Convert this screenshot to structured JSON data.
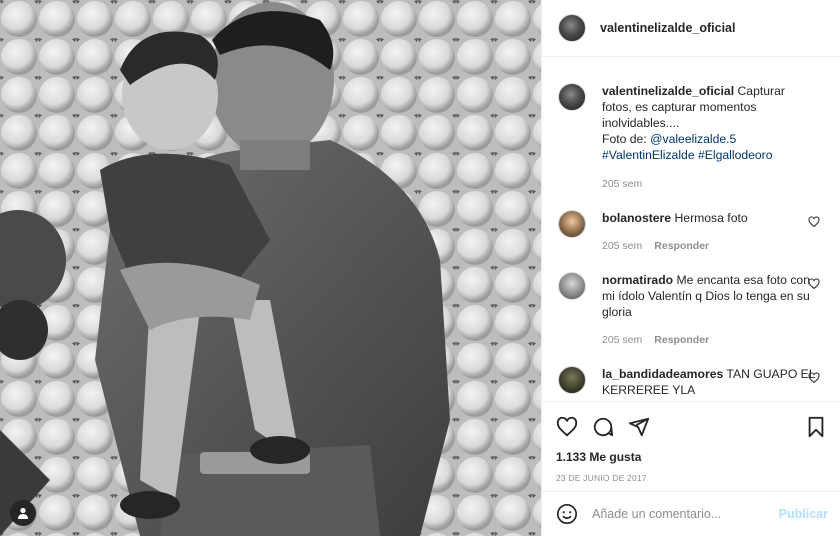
{
  "post": {
    "author": "valentinelizalde_oficial",
    "photo_alt": "Black and white photo"
  },
  "caption": {
    "user": "valentinelizalde_oficial",
    "text": "Capturar fotos, es capturar momentos inolvidables....",
    "credit_prefix": "Foto de: ",
    "credit_handle": "@valeelizalde.5",
    "hashtags": "#ValentinElizalde #Elgallodeoro",
    "time": "205 sem"
  },
  "comments": [
    {
      "user": "bolanostere",
      "text": "Hermosa foto",
      "time": "205 sem",
      "reply": "Responder"
    },
    {
      "user": "normatirado",
      "text": "Me encanta esa foto con mi ídolo Valentín q Dios lo tenga en su gloria",
      "time": "205 sem",
      "reply": "Responder"
    },
    {
      "user": "la_bandidadeamores",
      "text": "TAN GUAPO EL KERREREE YLA",
      "time": "",
      "reply": ""
    }
  ],
  "stats": {
    "likes": "1.133 Me gusta",
    "date": "23 DE JUNIO DE 2017"
  },
  "composer": {
    "placeholder": "Añade un comentario...",
    "publish": "Publicar"
  },
  "icons": {
    "like": "heart-icon",
    "comment": "comment-icon",
    "share": "share-icon",
    "save": "bookmark-icon",
    "emoji": "emoji-icon",
    "user": "user-icon"
  }
}
